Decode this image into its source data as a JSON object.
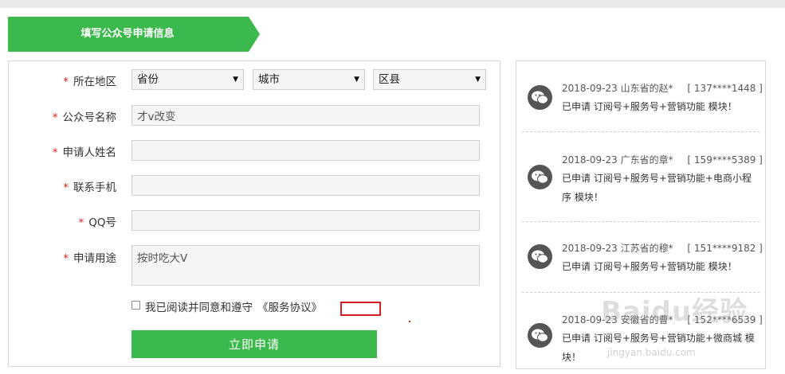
{
  "header": {
    "title": "填写公众号申请信息",
    "accent_color": "#3cb94d"
  },
  "form": {
    "region": {
      "label": "所在地区",
      "province": "省份",
      "city": "城市",
      "district": "区县"
    },
    "account_name": {
      "label": "公众号名称",
      "value": "才v改变"
    },
    "applicant_name": {
      "label": "申请人姓名",
      "value": ""
    },
    "phone": {
      "label": "联系手机",
      "value": ""
    },
    "qq": {
      "label": "QQ号",
      "value": ""
    },
    "purpose": {
      "label": "申请用途",
      "value": "按时吃大V"
    },
    "agreement": {
      "text": "我已阅读并同意和遵守",
      "link": "《服务协议》",
      "checked": false
    },
    "submit_label": "立即申请",
    "required_mark": "*"
  },
  "feed": {
    "items": [
      {
        "date": "2018-09-23",
        "who": "山东省的赵*",
        "phone": "[ 137****1448 ]",
        "text": "已申请 订阅号+服务号+营销功能 模块！"
      },
      {
        "date": "2018-09-23",
        "who": "广东省的章*",
        "phone": "[ 159****5389 ]",
        "text": "已申请 订阅号+服务号+营销功能+电商小程序 模块！"
      },
      {
        "date": "2018-09-23",
        "who": "江苏省的穆*",
        "phone": "[ 151****9182 ]",
        "text": "已申请 订阅号+服务号+营销功能 模块！"
      },
      {
        "date": "2018-09-23",
        "who": "安徽省的曹*",
        "phone": "[ 152****6539 ]",
        "text": "已申请 订阅号+服务号+营销功能+微商城 模块！"
      }
    ]
  },
  "watermark": {
    "main": "Baidu经验",
    "sub": "jingyan.baidu.com"
  },
  "icons": {
    "feed": "wechat-icon",
    "dropdown": "triangle-down-icon"
  }
}
